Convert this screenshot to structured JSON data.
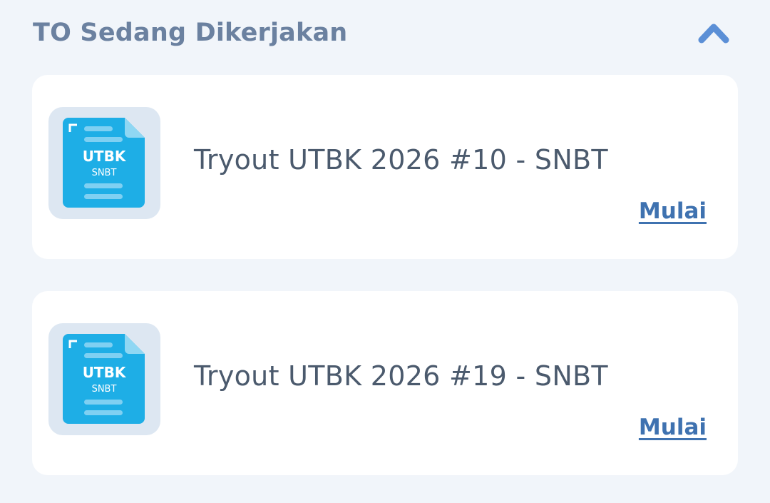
{
  "section": {
    "title": "TO Sedang Dikerjakan",
    "toggle_icon": "chevron-up-icon",
    "accent_color": "#5b8fd6"
  },
  "tryouts": [
    {
      "title": "Tryout UTBK 2026 #10 - SNBT",
      "icon_label_top": "UTBK",
      "icon_label_bottom": "SNBT",
      "action_label": "Mulai"
    },
    {
      "title": "Tryout UTBK 2026 #19 - SNBT",
      "icon_label_top": "UTBK",
      "icon_label_bottom": "SNBT",
      "action_label": "Mulai"
    }
  ],
  "colors": {
    "background": "#f1f5fa",
    "card": "#ffffff",
    "icon_doc": "#1eaee6",
    "link": "#3f72b0"
  }
}
